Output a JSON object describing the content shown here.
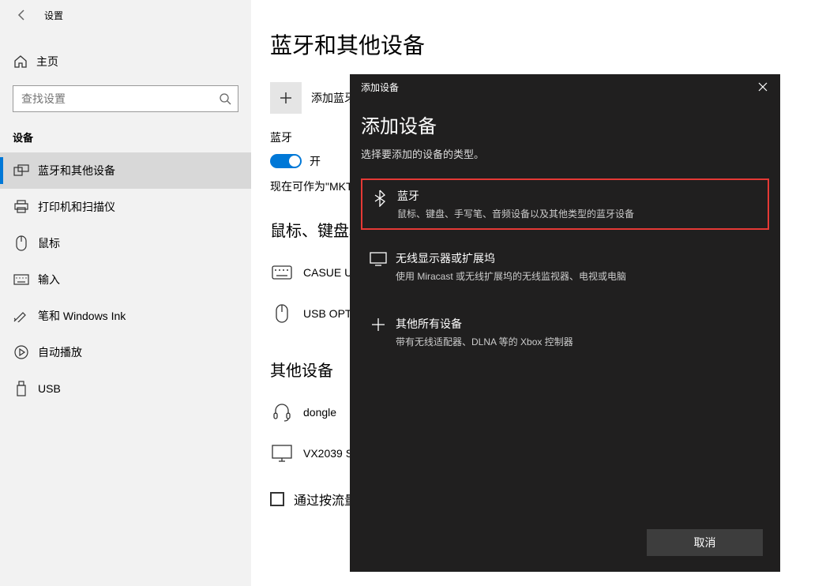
{
  "sidebar": {
    "settings_label": "设置",
    "home_label": "主页",
    "search_placeholder": "查找设置",
    "section_label": "设备",
    "items": [
      {
        "label": "蓝牙和其他设备"
      },
      {
        "label": "打印机和扫描仪"
      },
      {
        "label": "鼠标"
      },
      {
        "label": "输入"
      },
      {
        "label": "笔和 Windows Ink"
      },
      {
        "label": "自动播放"
      },
      {
        "label": "USB"
      }
    ]
  },
  "main": {
    "page_title": "蓝牙和其他设备",
    "add_device_label": "添加蓝牙",
    "bluetooth_section": "蓝牙",
    "toggle_label": "开",
    "discoverable": "现在可作为\"MKT",
    "mouse_keyboard_title": "鼠标、键盘和",
    "devices_mk": [
      {
        "label": "CASUE U"
      },
      {
        "label": "USB OPT"
      }
    ],
    "other_devices_title": "其他设备",
    "devices_other": [
      {
        "label": "dongle"
      },
      {
        "label": "VX2039 S"
      }
    ],
    "metered_label": "通过按流量计"
  },
  "modal": {
    "header_title": "添加设备",
    "title": "添加设备",
    "subtitle": "选择要添加的设备的类型。",
    "options": [
      {
        "title": "蓝牙",
        "desc": "鼠标、键盘、手写笔、音频设备以及其他类型的蓝牙设备"
      },
      {
        "title": "无线显示器或扩展坞",
        "desc": "使用 Miracast 或无线扩展坞的无线监视器、电视或电脑"
      },
      {
        "title": "其他所有设备",
        "desc": "带有无线适配器、DLNA 等的 Xbox 控制器"
      }
    ],
    "cancel_label": "取消"
  }
}
